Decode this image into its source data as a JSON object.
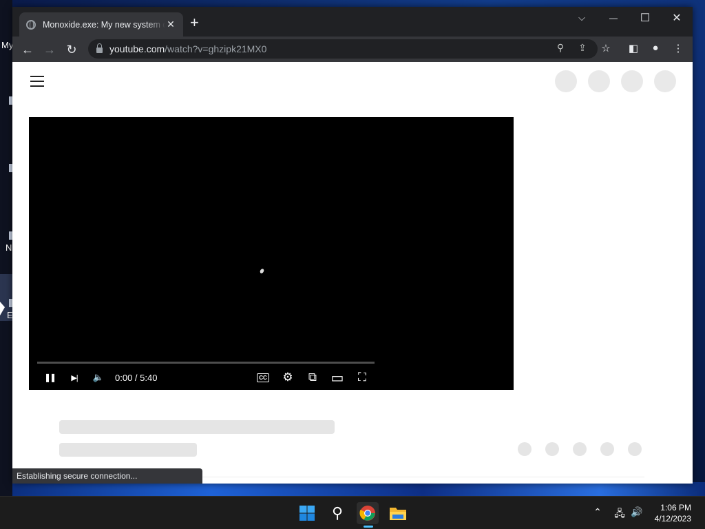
{
  "desktop": {
    "icon_labels": [
      "My",
      "N",
      "E"
    ]
  },
  "browser": {
    "tab": {
      "title": "Monoxide.exe: My new system d",
      "close_glyph": "✕"
    },
    "new_tab_glyph": "+",
    "window_controls": {
      "tab_search_glyph": "⌵",
      "minimize_glyph": "—",
      "maximize_glyph": "☐",
      "close_glyph": "✕"
    },
    "toolbar": {
      "back_glyph": "←",
      "forward_glyph": "→",
      "reload_glyph": "↻",
      "url_host": "youtube.com",
      "url_path": "/watch?v=ghzipk21MX0",
      "search_glyph": "⚲",
      "share_glyph": "⇪",
      "bookmark_glyph": "☆",
      "sidepanel_glyph": "◧",
      "profile_glyph": "●",
      "menu_glyph": "⋮"
    },
    "status_text": "Establishing secure connection..."
  },
  "player": {
    "time": "0:00 / 5:40",
    "progress_fraction": 0.0,
    "controls": {
      "pause_glyph": "❚❚",
      "next_glyph": "▶|",
      "volume_glyph": "🔈",
      "cc_label": "CC",
      "settings_glyph": "⚙",
      "miniplayer_glyph": "⧉",
      "theater_glyph": "▭",
      "fullscreen_glyph": "⛶"
    }
  },
  "taskbar": {
    "clock_time": "1:06 PM",
    "clock_date": "4/12/2023",
    "search_glyph": "⚲",
    "tray_chevron": "⌃",
    "network_glyph": "🖧",
    "volume_glyph": "🔊"
  },
  "colors": {
    "chrome_dark": "#202124",
    "chrome_toolbar": "#35363a",
    "taskbar": "#1c1c1c",
    "accent": "#4cc2ff",
    "progress": "#ff0000"
  }
}
